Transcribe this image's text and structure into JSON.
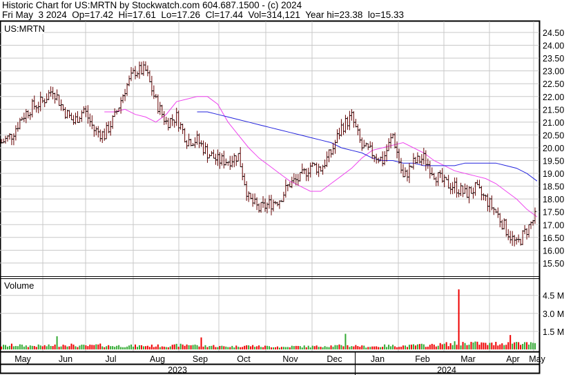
{
  "header": {
    "line1": "Historic Chart for US:MRTN by Stockwatch.com 604.687.1500 - (c) 2024",
    "line2": "Fri May  3 2024  Op=17.42  Hi=17.61  Lo=17.26  Cl=17.44  Vol=314,121  Year hi=23.38  lo=15.33"
  },
  "colors": {
    "up": "#33aa33",
    "down": "#ee0000",
    "bar": "#660000",
    "ma_short": "#ee44ee",
    "ma_long": "#2222dd",
    "grid": "#c8c8c8"
  },
  "chart_data": [
    {
      "type": "line",
      "title": "US:MRTN",
      "ylim": [
        15.0,
        25.0
      ],
      "y_ticks": [
        "24.50",
        "24.00",
        "23.50",
        "23.00",
        "22.50",
        "22.00",
        "21.50",
        "21.00",
        "20.50",
        "20.00",
        "19.50",
        "19.00",
        "18.50",
        "18.00",
        "17.50",
        "17.00",
        "16.50",
        "16.00",
        "15.50"
      ],
      "x_ticks": [
        "May",
        "Jun",
        "Jul",
        "Aug",
        "Sep",
        "Oct",
        "Nov",
        "Dec",
        "Jan",
        "Feb",
        "Mar",
        "Apr",
        "May"
      ],
      "years": [
        "2023",
        "2024"
      ],
      "weekly_close": [
        20.2,
        20.5,
        21.2,
        21.6,
        21.8,
        22.3,
        21.5,
        21.0,
        21.5,
        20.7,
        20.5,
        21.2,
        22.3,
        23.0,
        23.0,
        21.8,
        21.0,
        21.2,
        20.3,
        20.3,
        19.8,
        19.5,
        19.5,
        19.7,
        18.0,
        17.6,
        17.8,
        18.0,
        18.6,
        18.8,
        19.3,
        19.2,
        19.8,
        20.8,
        21.2,
        20.0,
        19.8,
        19.5,
        20.5,
        18.8,
        19.4,
        19.6,
        19.0,
        18.6,
        18.5,
        18.2,
        18.4,
        18.0,
        17.5,
        16.8,
        16.2,
        16.8,
        17.4
      ],
      "series": [
        {
          "name": "short moving average",
          "values": [
            21.4,
            21.4,
            21.5,
            21.3,
            21.2,
            21.0,
            21.3,
            21.8,
            21.9,
            22.0,
            22.0,
            21.7,
            21.0,
            20.5,
            20.0,
            19.6,
            19.3,
            19.0,
            18.7,
            18.5,
            18.3,
            18.3,
            18.6,
            18.9,
            19.2,
            19.6,
            19.9,
            20.0,
            20.1,
            20.2,
            20.0,
            19.8,
            19.5,
            19.3,
            19.1,
            19.0,
            18.9,
            18.8,
            18.6,
            18.3,
            18.0,
            17.6,
            17.3
          ]
        },
        {
          "name": "long moving average",
          "values": [
            21.4,
            21.4,
            21.3,
            21.2,
            21.1,
            21.0,
            20.9,
            20.8,
            20.7,
            20.6,
            20.5,
            20.4,
            20.3,
            20.2,
            20.0,
            19.9,
            19.8,
            19.6,
            19.5,
            19.5,
            19.4,
            19.4,
            19.3,
            19.3,
            19.3,
            19.3,
            19.4,
            19.4,
            19.4,
            19.4,
            19.3,
            19.2,
            19.0,
            18.7
          ]
        }
      ]
    },
    {
      "type": "bar",
      "title": "Volume",
      "ylim": [
        0,
        5.5
      ],
      "y_ticks": [
        "4.5 M",
        "3.0 M",
        "1.5 M"
      ],
      "weekly_volume_m": [
        0.3,
        0.35,
        0.3,
        0.3,
        0.3,
        0.35,
        0.4,
        0.3,
        0.3,
        0.35,
        0.3,
        0.3,
        0.3,
        0.3,
        0.3,
        0.3,
        0.3,
        0.35,
        0.4,
        0.3,
        0.3,
        0.25,
        0.25,
        0.3,
        0.3,
        0.25,
        0.25,
        0.2,
        0.25,
        0.25,
        0.25,
        0.3,
        0.3,
        0.3,
        0.3,
        0.25,
        0.25,
        0.3,
        0.3,
        0.3,
        0.35,
        0.35,
        0.4,
        0.45,
        0.5,
        0.55,
        0.5,
        0.45,
        0.5,
        0.6,
        0.6,
        0.45,
        0.35
      ],
      "spikes": [
        {
          "week": 5,
          "value": 1.1
        },
        {
          "week": 19,
          "value": 1.0
        },
        {
          "week": 33,
          "value": 1.3
        },
        {
          "week": 44,
          "value": 5.0
        },
        {
          "week": 49,
          "value": 1.2
        }
      ]
    }
  ]
}
